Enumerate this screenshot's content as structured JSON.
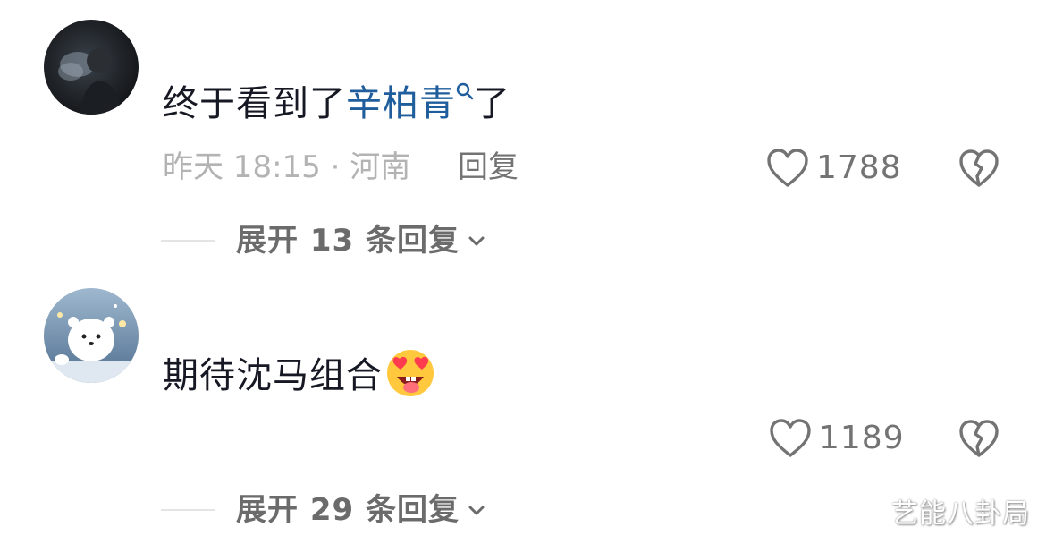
{
  "comments": [
    {
      "text_before": "终于看到了",
      "link_text": "辛柏青",
      "text_after": "了",
      "meta": "昨天 18:15 · 河南",
      "reply_label": "回复",
      "like_count": "1788",
      "expand_label": "展开 13 条回复"
    },
    {
      "text": "期待沈马组合",
      "emoji": "heart-eyes-emoji",
      "like_count": "1189",
      "expand_label": "展开 29 条回复"
    }
  ],
  "watermark": "艺能八卦局",
  "colors": {
    "text": "#161823",
    "link": "#1f5d9c",
    "muted": "#b3b3b3",
    "secondary": "#737373"
  },
  "icons": [
    "search-icon",
    "heart-icon",
    "broken-heart-icon",
    "chevron-down-icon"
  ]
}
